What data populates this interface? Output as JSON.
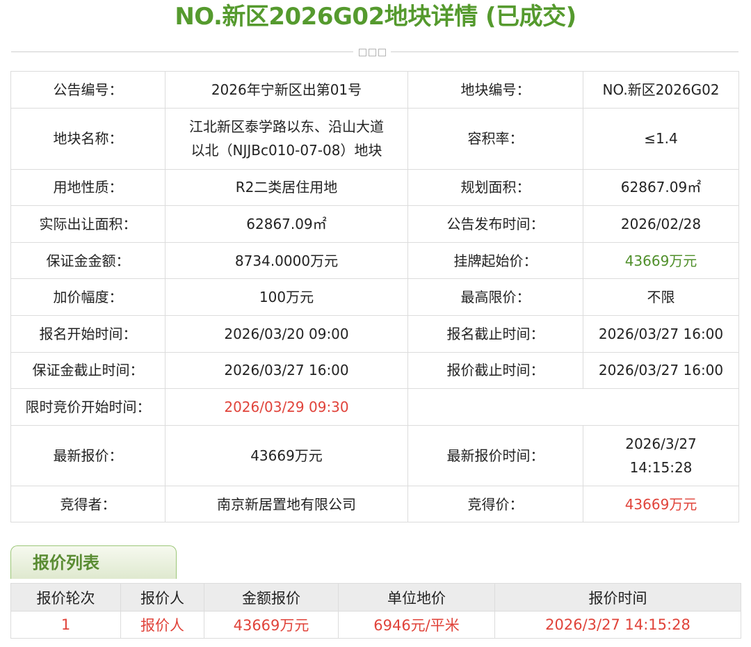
{
  "page": {
    "title": "NO.新区2026G02地块详情 (已成交)"
  },
  "colors": {
    "title_green": "#559a2e",
    "highlight_green": "#4f8f2a",
    "highlight_red": "#e0433a",
    "border": "#dcdcdc",
    "header_bg": "#ececec"
  },
  "info": {
    "announcement_no_label": "公告编号：",
    "announcement_no": "2026年宁新区出第01号",
    "plot_no_label": "地块编号：",
    "plot_no": "NO.新区2026G02",
    "plot_name_label": "地块名称：",
    "plot_name_line1": "江北新区泰学路以东、沿山大道",
    "plot_name_line2": "以北（NJJBc010-07-08）地块",
    "far_label": "容积率：",
    "far": "≤1.4",
    "land_use_label": "用地性质：",
    "land_use": "R2二类居住用地",
    "planned_area_label": "规划面积：",
    "planned_area": "62867.09㎡",
    "actual_area_label": "实际出让面积：",
    "actual_area": "62867.09㎡",
    "publish_time_label": "公告发布时间：",
    "publish_time": "2026/02/28",
    "deposit_label": "保证金金额：",
    "deposit": "8734.0000万元",
    "start_price_label": "挂牌起始价：",
    "start_price": "43669万元",
    "increment_label": "加价幅度：",
    "increment": "100万元",
    "max_price_label": "最高限价：",
    "max_price": "不限",
    "reg_start_label": "报名开始时间：",
    "reg_start": "2026/03/20 09:00",
    "reg_end_label": "报名截止时间：",
    "reg_end": "2026/03/27 16:00",
    "deposit_deadline_label": "保证金截止时间：",
    "deposit_deadline": "2026/03/27 16:00",
    "quote_deadline_label": "报价截止时间：",
    "quote_deadline": "2026/03/27 16:00",
    "auction_start_label": "限时竞价开始时间：",
    "auction_start": "2026/03/29 09:30",
    "latest_quote_label": "最新报价：",
    "latest_quote": "43669万元",
    "latest_quote_time_label": "最新报价时间：",
    "latest_quote_time_line1": "2026/3/27",
    "latest_quote_time_line2": "14:15:28",
    "winner_label": "竞得者：",
    "winner": "南京新居置地有限公司",
    "winning_price_label": "竞得价：",
    "winning_price": "43669万元"
  },
  "bids": {
    "tab_label": "报价列表",
    "headers": [
      "报价轮次",
      "报价人",
      "金额报价",
      "单位地价",
      "报价时间"
    ],
    "rows": [
      [
        "1",
        "报价人",
        "43669万元",
        "6946元/平米",
        "2026/3/27 14:15:28"
      ]
    ]
  }
}
